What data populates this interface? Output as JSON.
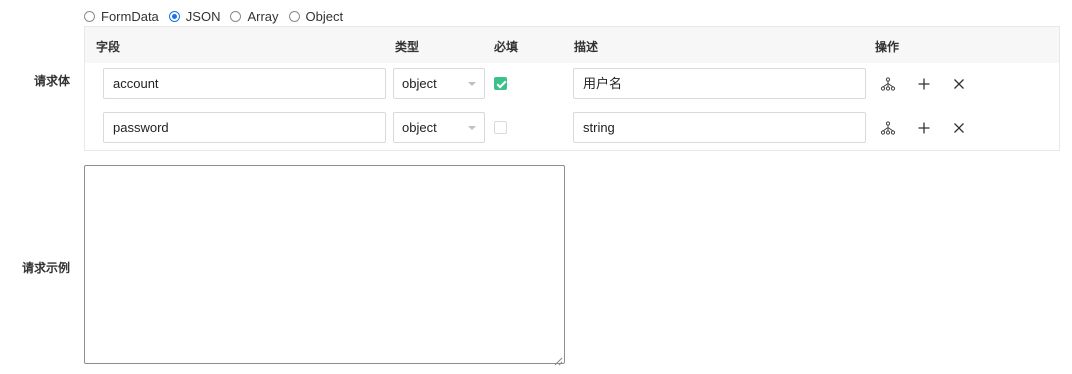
{
  "body_type": {
    "options": [
      "FormData",
      "JSON",
      "Array",
      "Object"
    ],
    "selected": "JSON"
  },
  "labels": {
    "request_body": "请求体",
    "request_example": "请求示例"
  },
  "table": {
    "headers": {
      "field": "字段",
      "type": "类型",
      "required": "必填",
      "description": "描述",
      "actions": "操作"
    },
    "rows": [
      {
        "field": "account",
        "type": "object",
        "required": true,
        "description": "用户名"
      },
      {
        "field": "password",
        "type": "object",
        "required": false,
        "description": "string"
      }
    ]
  },
  "example": {
    "value": ""
  },
  "colors": {
    "radio_accent": "#1a73e8",
    "checkbox_checked": "#3cc18a",
    "header_bg": "#f7f7f8"
  },
  "icons": [
    "tree-structure-icon",
    "plus-icon",
    "close-icon",
    "chevron-down-icon"
  ]
}
